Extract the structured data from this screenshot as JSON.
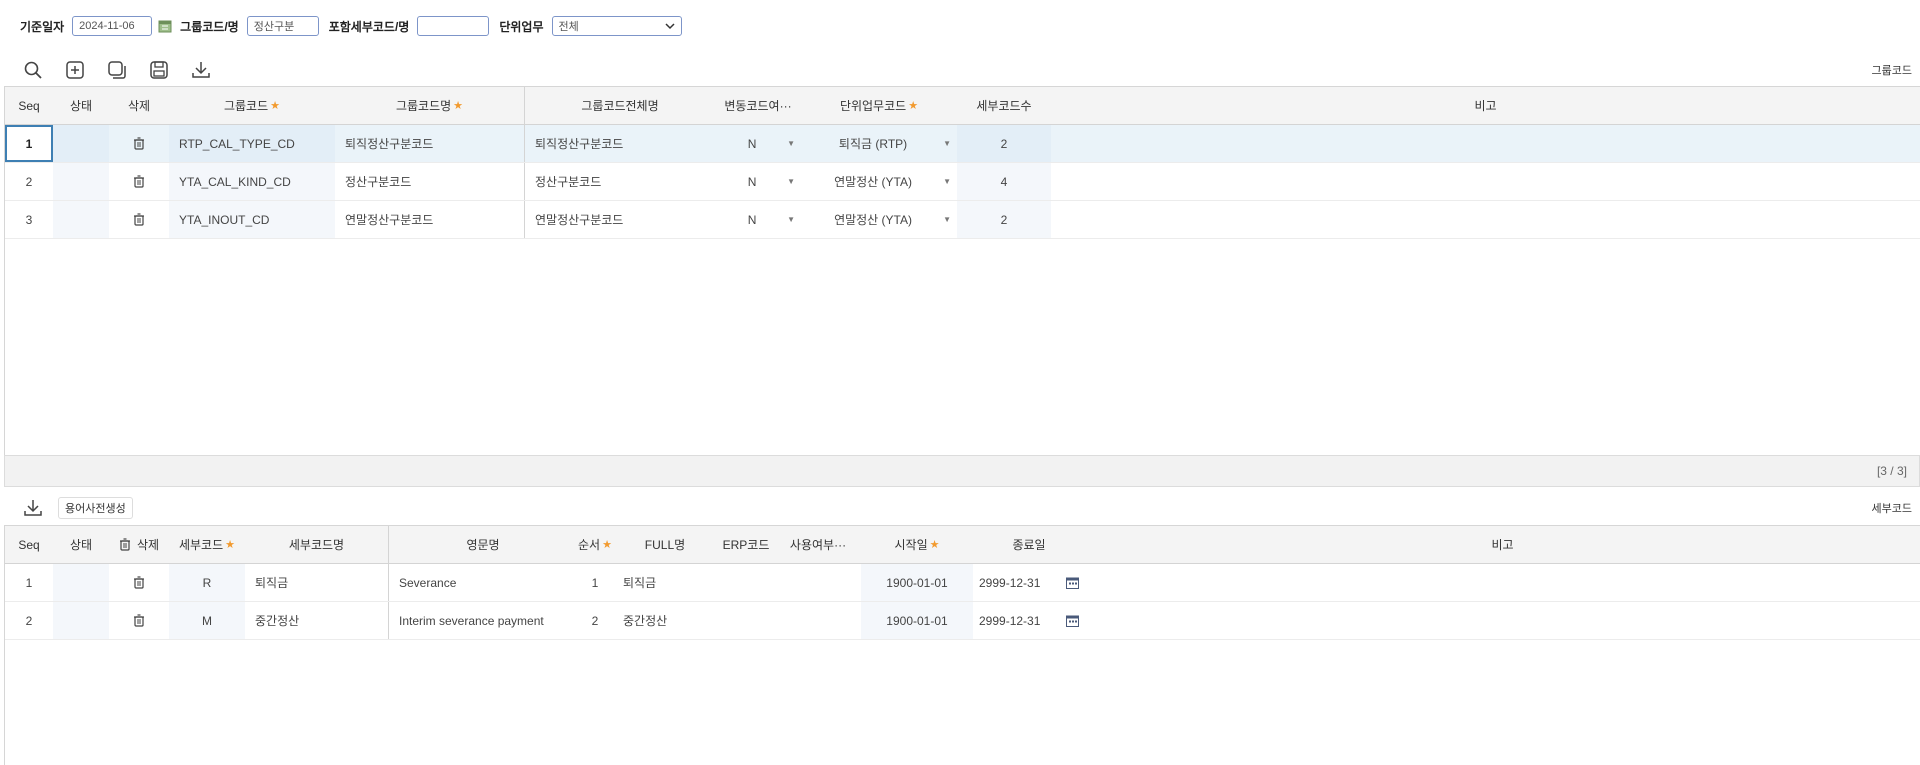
{
  "search": {
    "date_label": "기준일자",
    "date_value": "2024-11-06",
    "group_label": "그룹코드/명",
    "group_value": "정산구분",
    "detail_label": "포함세부코드/명",
    "detail_value": "",
    "unit_label": "단위업무",
    "unit_value": "전체"
  },
  "top_toolbar": {
    "right_label": "그룹코드"
  },
  "group_grid": {
    "headers": {
      "seq": "Seq",
      "status": "상태",
      "delete": "삭제",
      "group_code": "그룹코드",
      "group_name": "그룹코드명",
      "group_full_name": "그룹코드전체명",
      "change_flag": "변동코드여···",
      "unit_code": "단위업무코드",
      "detail_count": "세부코드수",
      "remark": "비고"
    },
    "rows": [
      {
        "seq": "1",
        "status": "",
        "group_code": "RTP_CAL_TYPE_CD",
        "group_name": "퇴직정산구분코드",
        "group_full_name": "퇴직정산구분코드",
        "change_flag": "N",
        "unit_code": "퇴직금 (RTP)",
        "detail_count": "2",
        "remark": ""
      },
      {
        "seq": "2",
        "status": "",
        "group_code": "YTA_CAL_KIND_CD",
        "group_name": "정산구분코드",
        "group_full_name": "정산구분코드",
        "change_flag": "N",
        "unit_code": "연말정산 (YTA)",
        "detail_count": "4",
        "remark": ""
      },
      {
        "seq": "3",
        "status": "",
        "group_code": "YTA_INOUT_CD",
        "group_name": "연말정산구분코드",
        "group_full_name": "연말정산구분코드",
        "change_flag": "N",
        "unit_code": "연말정산 (YTA)",
        "detail_count": "2",
        "remark": ""
      }
    ],
    "pager": "[3 / 3]"
  },
  "bottom_toolbar": {
    "dict_button": "용어사전생성",
    "right_label": "세부코드"
  },
  "detail_grid": {
    "headers": {
      "seq": "Seq",
      "status": "상태",
      "delete": "삭제",
      "detail_code": "세부코드",
      "detail_name": "세부코드명",
      "english_name": "영문명",
      "order": "순서",
      "full_name": "FULL명",
      "erp_code": "ERP코드",
      "use_flag": "사용여부···",
      "start_date": "시작일",
      "end_date": "종료일",
      "remark": "비고"
    },
    "rows": [
      {
        "seq": "1",
        "status": "",
        "detail_code": "R",
        "detail_name": "퇴직금",
        "english_name": "Severance",
        "order": "1",
        "full_name": "퇴직금",
        "erp_code": "",
        "use_flag": "",
        "start_date": "1900-01-01",
        "end_date": "2999-12-31",
        "remark": ""
      },
      {
        "seq": "2",
        "status": "",
        "detail_code": "M",
        "detail_name": "중간정산",
        "english_name": "Interim severance payment",
        "order": "2",
        "full_name": "중간정산",
        "erp_code": "",
        "use_flag": "",
        "start_date": "1900-01-01",
        "end_date": "2999-12-31",
        "remark": ""
      }
    ]
  },
  "colors": {
    "accent": "#3e7fb3",
    "required_star": "#f29a2e",
    "input_border": "#7d95c9",
    "selected_row": "#eaf3f9"
  },
  "icons": [
    "calendar-icon",
    "search-icon",
    "add-icon",
    "copy-icon",
    "save-icon",
    "download-icon",
    "trash-icon",
    "chevron-down-icon"
  ]
}
